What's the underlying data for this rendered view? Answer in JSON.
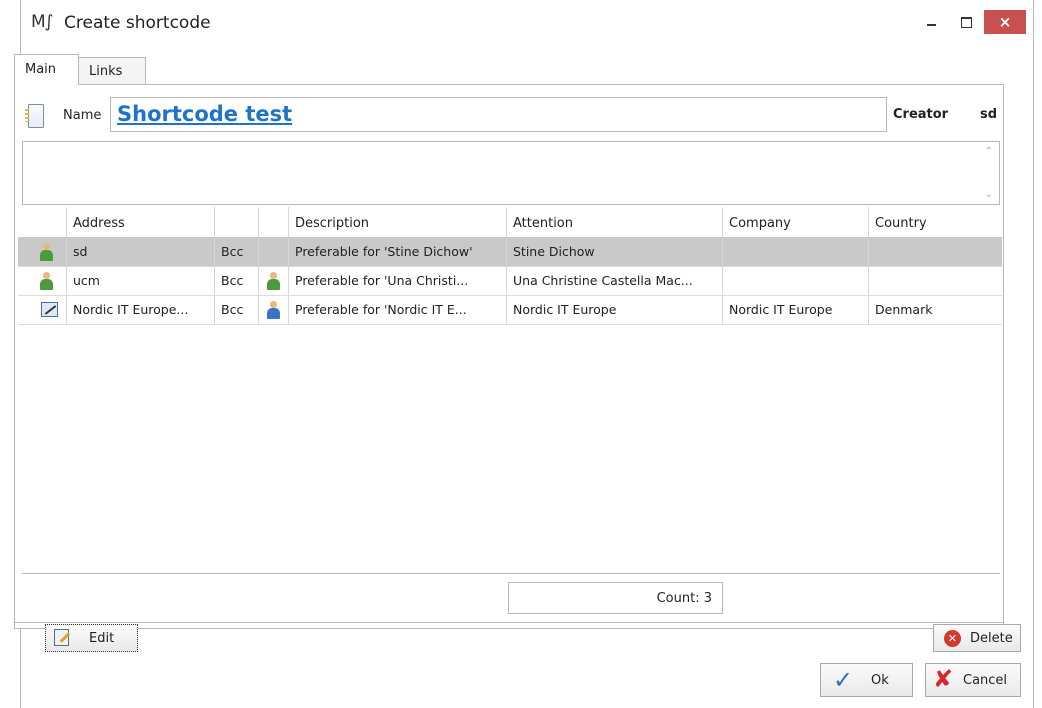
{
  "window": {
    "app_icon": "M∫",
    "title": "Create shortcode",
    "minimize": "minimize-icon",
    "maximize": "maximize-icon",
    "close": "×"
  },
  "tabs": [
    {
      "label": "Main",
      "active": true
    },
    {
      "label": "Links",
      "active": false
    }
  ],
  "form": {
    "name_label": "Name",
    "name_value": "Shortcode test",
    "creator_label": "Creator",
    "creator_value": "sd",
    "notes_value": ""
  },
  "grid": {
    "columns": [
      "Address",
      "",
      "",
      "Description",
      "Attention",
      "Company",
      "Country"
    ],
    "rows": [
      {
        "icon": "person-green-icon",
        "address": "sd",
        "type": "Bcc",
        "pref_icon": "",
        "description": "Preferable for 'Stine Dichow'",
        "attention": "Stine Dichow",
        "company": "",
        "country": "",
        "selected": true
      },
      {
        "icon": "person-green-icon",
        "address": "ucm",
        "type": "Bcc",
        "pref_icon": "person-green-icon",
        "description": "Preferable for 'Una Christi...",
        "attention": "Una Christine Castella Mac...",
        "company": "",
        "country": "",
        "selected": false
      },
      {
        "icon": "pen-icon",
        "address": "Nordic IT Europe...",
        "type": "Bcc",
        "pref_icon": "person-blue-icon",
        "description": "Preferable for 'Nordic IT E...",
        "attention": "Nordic IT Europe",
        "company": "Nordic IT Europe",
        "country": "Denmark",
        "selected": false
      }
    ],
    "count_label": "Count: 3"
  },
  "buttons": {
    "edit": "Edit",
    "delete": "Delete",
    "ok": "Ok",
    "cancel": "Cancel"
  },
  "colors": {
    "close_bg": "#c75050",
    "name_link": "#1f74c8",
    "selected_row": "#c9c9c9"
  }
}
